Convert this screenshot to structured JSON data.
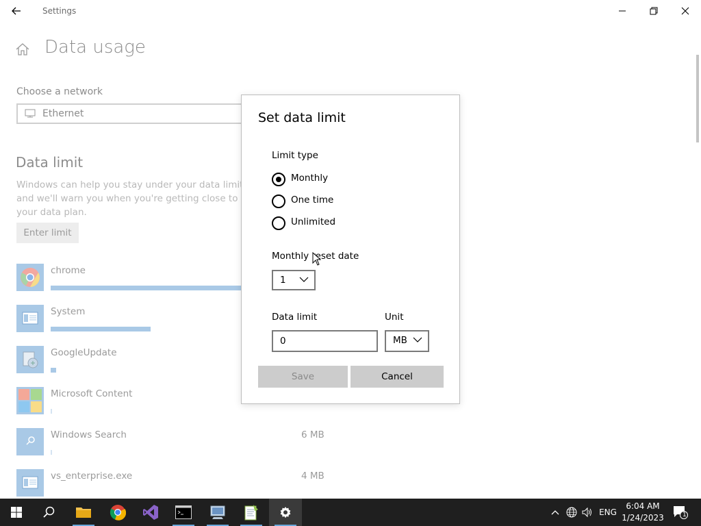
{
  "window": {
    "title": "Settings"
  },
  "page": {
    "title": "Data usage",
    "network_label": "Choose a network",
    "network_value": "Ethernet",
    "section_title": "Data limit",
    "description_lines": [
      "Windows can help you stay under your data limit. Ent",
      "and we'll warn you when you're getting close to it. Th",
      "your data plan."
    ],
    "enter_limit_label": "Enter limit",
    "apps": [
      {
        "name": "chrome",
        "size": "",
        "usage_fraction": 1.0
      },
      {
        "name": "System",
        "size": "",
        "usage_fraction": 0.52
      },
      {
        "name": "GoogleUpdate",
        "size": "",
        "usage_fraction": 0.03
      },
      {
        "name": "Microsoft Content",
        "size": "",
        "usage_fraction": 0.005
      },
      {
        "name": "Windows Search",
        "size": "6 MB",
        "usage_fraction": 0.005
      },
      {
        "name": "vs_enterprise.exe",
        "size": "4 MB",
        "usage_fraction": 0.0
      }
    ]
  },
  "dialog": {
    "title": "Set data limit",
    "limit_type_label": "Limit type",
    "limit_types": [
      {
        "label": "Monthly",
        "selected": true
      },
      {
        "label": "One time",
        "selected": false
      },
      {
        "label": "Unlimited",
        "selected": false
      }
    ],
    "reset_date_label": "Monthly reset date",
    "reset_date_value": "1",
    "data_limit_label": "Data limit",
    "data_limit_value": "0",
    "unit_label": "Unit",
    "unit_value": "MB",
    "save_label": "Save",
    "cancel_label": "Cancel"
  },
  "taskbar": {
    "language": "ENG",
    "time": "6:04 AM",
    "date": "1/24/2023",
    "notification_count": "1",
    "accent_color": "#6aa8dc"
  }
}
